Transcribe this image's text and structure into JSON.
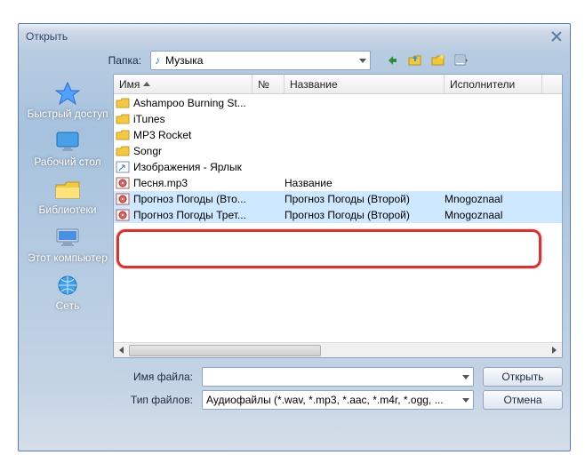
{
  "title": "Открыть",
  "folder": {
    "label": "Папка:",
    "value": "Музыка"
  },
  "headers": {
    "name": "Имя",
    "no": "№",
    "title_col": "Название",
    "artists": "Исполнители"
  },
  "files": [
    {
      "icon": "folder",
      "name": "Ashampoo Burning St...",
      "title": "",
      "artist": ""
    },
    {
      "icon": "folder",
      "name": "iTunes",
      "title": "",
      "artist": ""
    },
    {
      "icon": "folder",
      "name": "MP3 Rocket",
      "title": "",
      "artist": ""
    },
    {
      "icon": "folder",
      "name": "Songr",
      "title": "",
      "artist": ""
    },
    {
      "icon": "link",
      "name": "Изображения - Ярлык",
      "title": "",
      "artist": ""
    },
    {
      "icon": "audio",
      "name": "Песня.mp3",
      "title": "Название",
      "artist": ""
    },
    {
      "icon": "audio",
      "name": "Прогноз Погоды (Вто...",
      "title": "Прогноз Погоды (Второй)",
      "artist": "Mnogoznaal",
      "selected": true
    },
    {
      "icon": "audio",
      "name": "Прогноз Погоды Трет...",
      "title": "Прогноз Погоды (Второй)",
      "artist": "Mnogoznaal",
      "selected": true
    }
  ],
  "filename": {
    "label": "Имя файла:",
    "value": ""
  },
  "filetype": {
    "label": "Тип файлов:",
    "value": "Аудиофайлы (*.wav, *.mp3, *.aac, *.m4r, *.ogg, ..."
  },
  "buttons": {
    "open": "Открыть",
    "cancel": "Отмена"
  },
  "places": {
    "quick": "Быстрый доступ",
    "desktop": "Рабочий стол",
    "libraries": "Библиотеки",
    "thispc": "Этот компьютер",
    "network": "Сеть"
  }
}
